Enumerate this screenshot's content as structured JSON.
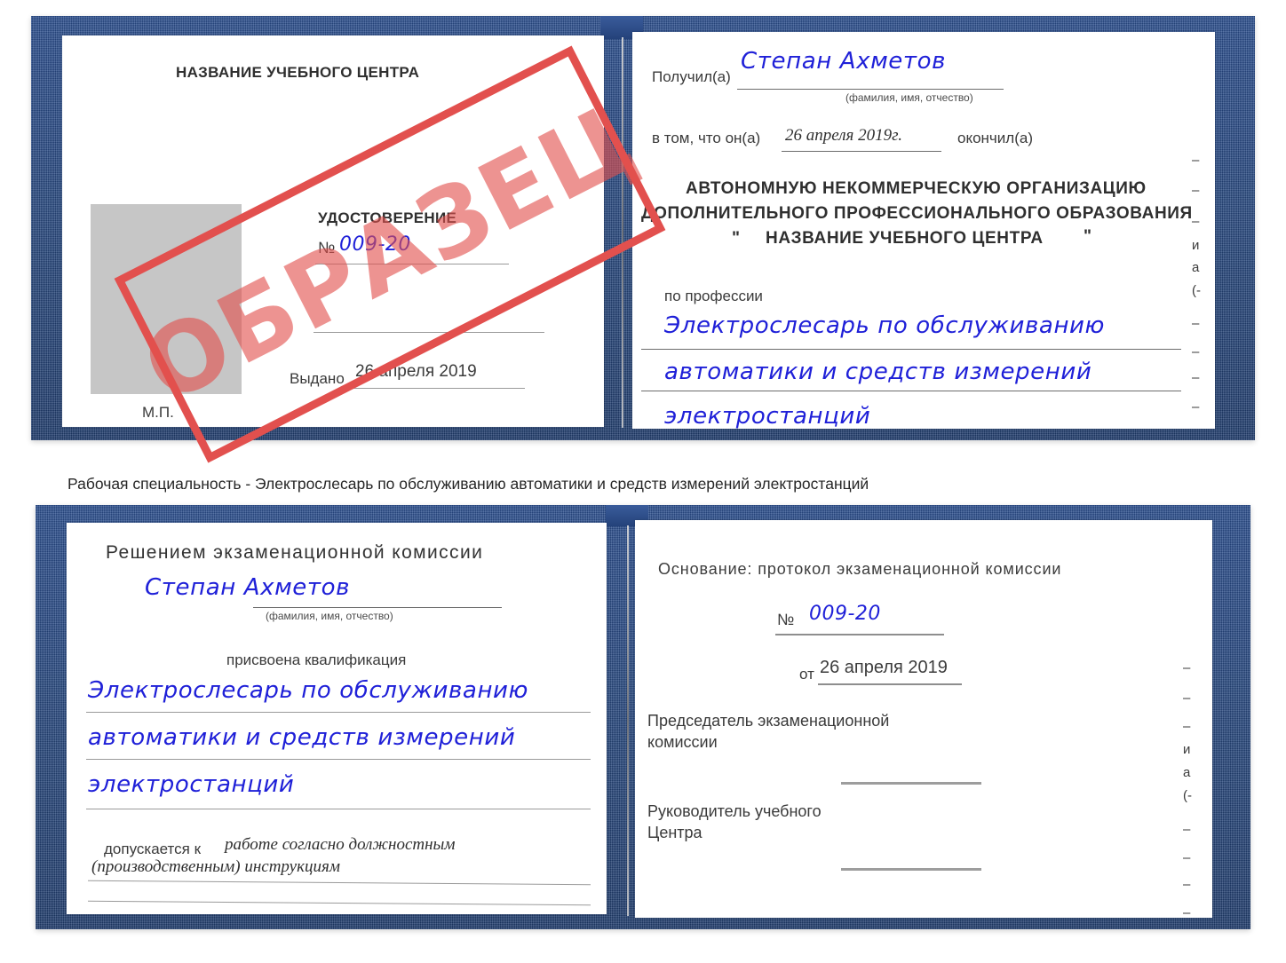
{
  "document": {
    "type": "certificate-scan",
    "caption": "Рабочая специальность - Электрослесарь по обслуживанию автоматики и средств измерений электростанций",
    "watermark": "ОБРАЗЕЦ",
    "colors": {
      "cover_blue": "#27487f",
      "ink_blue": "#1f20d8",
      "stamp_red": "#e2504e",
      "photo_gray": "#c6c6c6",
      "text_gray": "#3c3c3c"
    }
  },
  "certificate_top": {
    "left_page": {
      "center_name_label": "НАЗВАНИЕ УЧЕБНОГО ЦЕНТРА",
      "title": "УДОСТОВЕРЕНИЕ",
      "number_prefix": "№",
      "number_value": "009-20",
      "issued_label": "Выдано",
      "issued_value": "26 апреля 2019",
      "seal_label": "М.П."
    },
    "right_page": {
      "received_label": "Получил(а)",
      "received_value": "Степан Ахметов",
      "name_hint": "(фамилия, имя, отчество)",
      "in_that_label": "в том, что он(а)",
      "completion_date": "26 апреля 2019г.",
      "graduated_label": "окончил(а)",
      "org_line_1": "АВТОНОМНУЮ НЕКОММЕРЧЕСКУЮ ОРГАНИЗАЦИЮ",
      "org_line_2": "ДОПОЛНИТЕЛЬНОГО ПРОФЕССИОНАЛЬНОГО ОБРАЗОВАНИЯ",
      "org_quote_open": "\"",
      "org_line_3": "НАЗВАНИЕ УЧЕБНОГО ЦЕНТРА",
      "org_quote_close": "\"",
      "profession_label": "по профессии",
      "profession_line_1": "Электрослесарь по обслуживанию",
      "profession_line_2": "автоматики и средств измерений",
      "profession_line_3": "электростанций",
      "margin_fragments": [
        "–",
        "–",
        "–",
        "и",
        "а",
        "(-",
        "–",
        "–",
        "–",
        "–"
      ]
    }
  },
  "certificate_bottom": {
    "left_page": {
      "heading": "Решением экзаменационной комиссии",
      "name_value": "Степан Ахметов",
      "name_hint": "(фамилия, имя, отчество)",
      "qualification_label": "присвоена квалификация",
      "qualification_line_1": "Электрослесарь по обслуживанию",
      "qualification_line_2": "автоматики и средств измерений",
      "qualification_line_3": "электростанций",
      "admitted_label": "допускается к",
      "admitted_value_1": "работе согласно должностным",
      "admitted_value_2": "(производственным) инструкциям"
    },
    "right_page": {
      "basis_label": "Основание: протокол экзаменационной комиссии",
      "number_prefix": "№",
      "number_value": "009-20",
      "date_prefix": "от",
      "date_value": "26 апреля 2019",
      "chairman_line_1": "Председатель экзаменационной",
      "chairman_line_2": "комиссии",
      "head_line_1": "Руководитель учебного",
      "head_line_2": "Центра",
      "margin_fragments": [
        "–",
        "–",
        "–",
        "и",
        "а",
        "(-",
        "–",
        "–",
        "–",
        "–"
      ]
    }
  }
}
